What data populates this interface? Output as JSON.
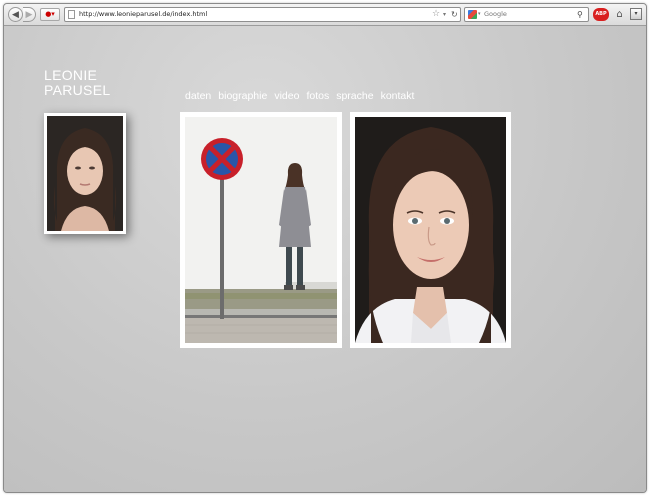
{
  "browser": {
    "url": "http://www.leonieparusel.de/index.html",
    "search_placeholder": "Google",
    "back_glyph": "◀",
    "forward_glyph": "▶",
    "bookmark_glyph": "●▾",
    "star_glyph": "☆",
    "dropdown_glyph": "▾",
    "reload_glyph": "↻",
    "magnifier_glyph": "⚲",
    "abp_label": "ABP",
    "home_glyph": "⌂",
    "menu_glyph": "▾",
    "icons": [
      "back-icon",
      "forward-icon",
      "bookmark-icon",
      "page-icon",
      "star-icon",
      "reload-icon",
      "google-icon",
      "magnifier-icon",
      "adblock-icon",
      "home-icon",
      "menu-icon"
    ]
  },
  "site": {
    "title_line1": "LEONIE",
    "title_line2": "PARUSEL",
    "nav": [
      {
        "label": "daten"
      },
      {
        "label": "biographie"
      },
      {
        "label": "video"
      },
      {
        "label": "fotos"
      },
      {
        "label": "sprache"
      },
      {
        "label": "kontakt"
      }
    ],
    "colors": {
      "background": "#c9c9c9",
      "text": "#ffffff",
      "frame": "#ffffff"
    }
  }
}
